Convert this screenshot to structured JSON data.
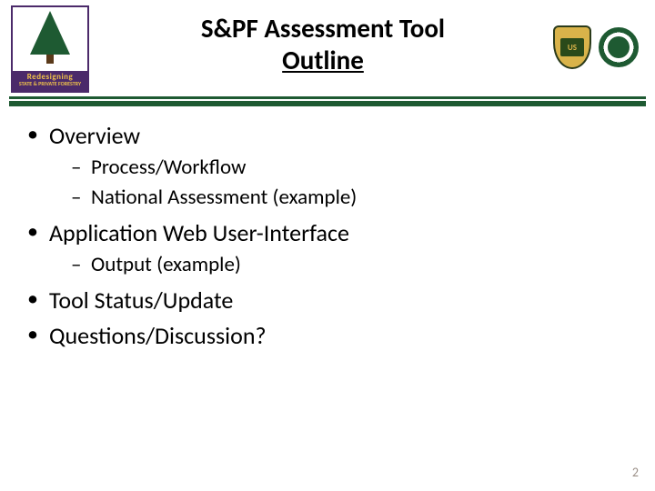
{
  "header": {
    "title_line1": "S&PF Assessment Tool",
    "title_line2": "Outline",
    "logo_left": {
      "top": "Redesigning",
      "bottom": "STATE & PRIVATE FORESTRY"
    },
    "logo_middle": "US",
    "logo_right_name": "dept-seal"
  },
  "bullets": {
    "items": [
      {
        "label": "Overview",
        "sub": [
          "Process/Workflow",
          "National  Assessment (example)"
        ]
      },
      {
        "label": "Application Web User-Interface",
        "sub": [
          "Output (example)"
        ]
      },
      {
        "label": "Tool Status/Update",
        "sub": []
      },
      {
        "label": "Questions/Discussion?",
        "sub": []
      }
    ]
  },
  "page_number": "2"
}
